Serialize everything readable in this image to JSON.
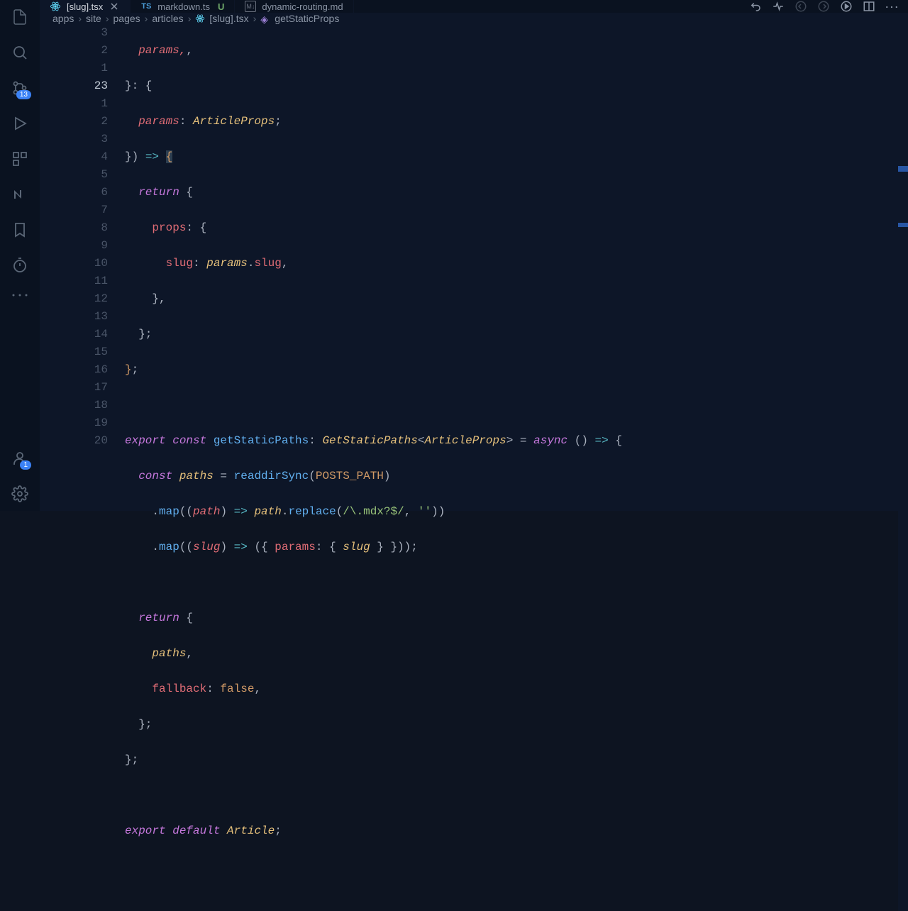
{
  "activity": {
    "scm_badge": "13",
    "account_badge": "1"
  },
  "tabs": [
    {
      "label": "[slug].tsx",
      "icon": "react",
      "active": true,
      "closable": true
    },
    {
      "label": "markdown.ts",
      "icon": "ts",
      "status": "U",
      "active": false
    },
    {
      "label": "dynamic-routing.md",
      "icon": "md",
      "active": false
    }
  ],
  "breadcrumbs": [
    {
      "label": "apps"
    },
    {
      "label": "site"
    },
    {
      "label": "pages"
    },
    {
      "label": "articles"
    },
    {
      "label": "[slug].tsx",
      "icon": "react"
    },
    {
      "label": "getStaticProps",
      "icon": "symbol"
    }
  ],
  "gutter": [
    "3",
    "2",
    "1",
    "23",
    "1",
    "2",
    "3",
    "4",
    "5",
    "6",
    "7",
    "8",
    "9",
    "10",
    "11",
    "12",
    "13",
    "14",
    "15",
    "16",
    "17",
    "18",
    "19",
    "20"
  ],
  "current_line_index": 3,
  "code": {
    "l0": "  params,",
    "l1": "}: {",
    "l2_a": "  params",
    "l2_b": ": ",
    "l2_c": "ArticleProps",
    "l2_d": ";",
    "l3_a": "}) ",
    "l3_b": "=>",
    "l3_c": " {",
    "l4_a": "  ",
    "l4_b": "return",
    "l4_c": " {",
    "l5_a": "    ",
    "l5_b": "props",
    "l5_c": ": {",
    "l6_a": "      ",
    "l6_b": "slug",
    "l6_c": ": ",
    "l6_d": "params",
    "l6_e": ".",
    "l6_f": "slug",
    "l6_g": ",",
    "l7": "    },",
    "l8": "  };",
    "l9": "};",
    "l10": "",
    "l11_a": "export const ",
    "l11_b": "getStaticPaths",
    "l11_c": ": ",
    "l11_d": "GetStaticPaths",
    "l11_e": "<",
    "l11_f": "ArticleProps",
    "l11_g": "> = ",
    "l11_h": "async",
    "l11_i": " () ",
    "l11_j": "=>",
    "l11_k": " {",
    "l12_a": "  ",
    "l12_b": "const ",
    "l12_c": "paths",
    "l12_d": " = ",
    "l12_e": "readdirSync",
    "l12_f": "(",
    "l12_g": "POSTS_PATH",
    "l12_h": ")",
    "l13_a": "    .",
    "l13_b": "map",
    "l13_c": "((",
    "l13_d": "path",
    "l13_e": ") ",
    "l13_f": "=>",
    "l13_g": " ",
    "l13_h": "path",
    "l13_i": ".",
    "l13_j": "replace",
    "l13_k": "(",
    "l13_l": "/\\.mdx?$/",
    "l13_m": ", ",
    "l13_n": "''",
    "l13_o": "))",
    "l14_a": "    .",
    "l14_b": "map",
    "l14_c": "((",
    "l14_d": "slug",
    "l14_e": ") ",
    "l14_f": "=>",
    "l14_g": " ({ ",
    "l14_h": "params",
    "l14_i": ": { ",
    "l14_j": "slug",
    "l14_k": " } }));",
    "l15": "",
    "l16_a": "  ",
    "l16_b": "return",
    "l16_c": " {",
    "l17_a": "    ",
    "l17_b": "paths",
    "l17_c": ",",
    "l18_a": "    ",
    "l18_b": "fallback",
    "l18_c": ": ",
    "l18_d": "false",
    "l18_e": ",",
    "l19": "  };",
    "l20": "};",
    "l21": "",
    "l22_a": "export default ",
    "l22_b": "Article",
    "l22_c": ";",
    "l23": ""
  }
}
